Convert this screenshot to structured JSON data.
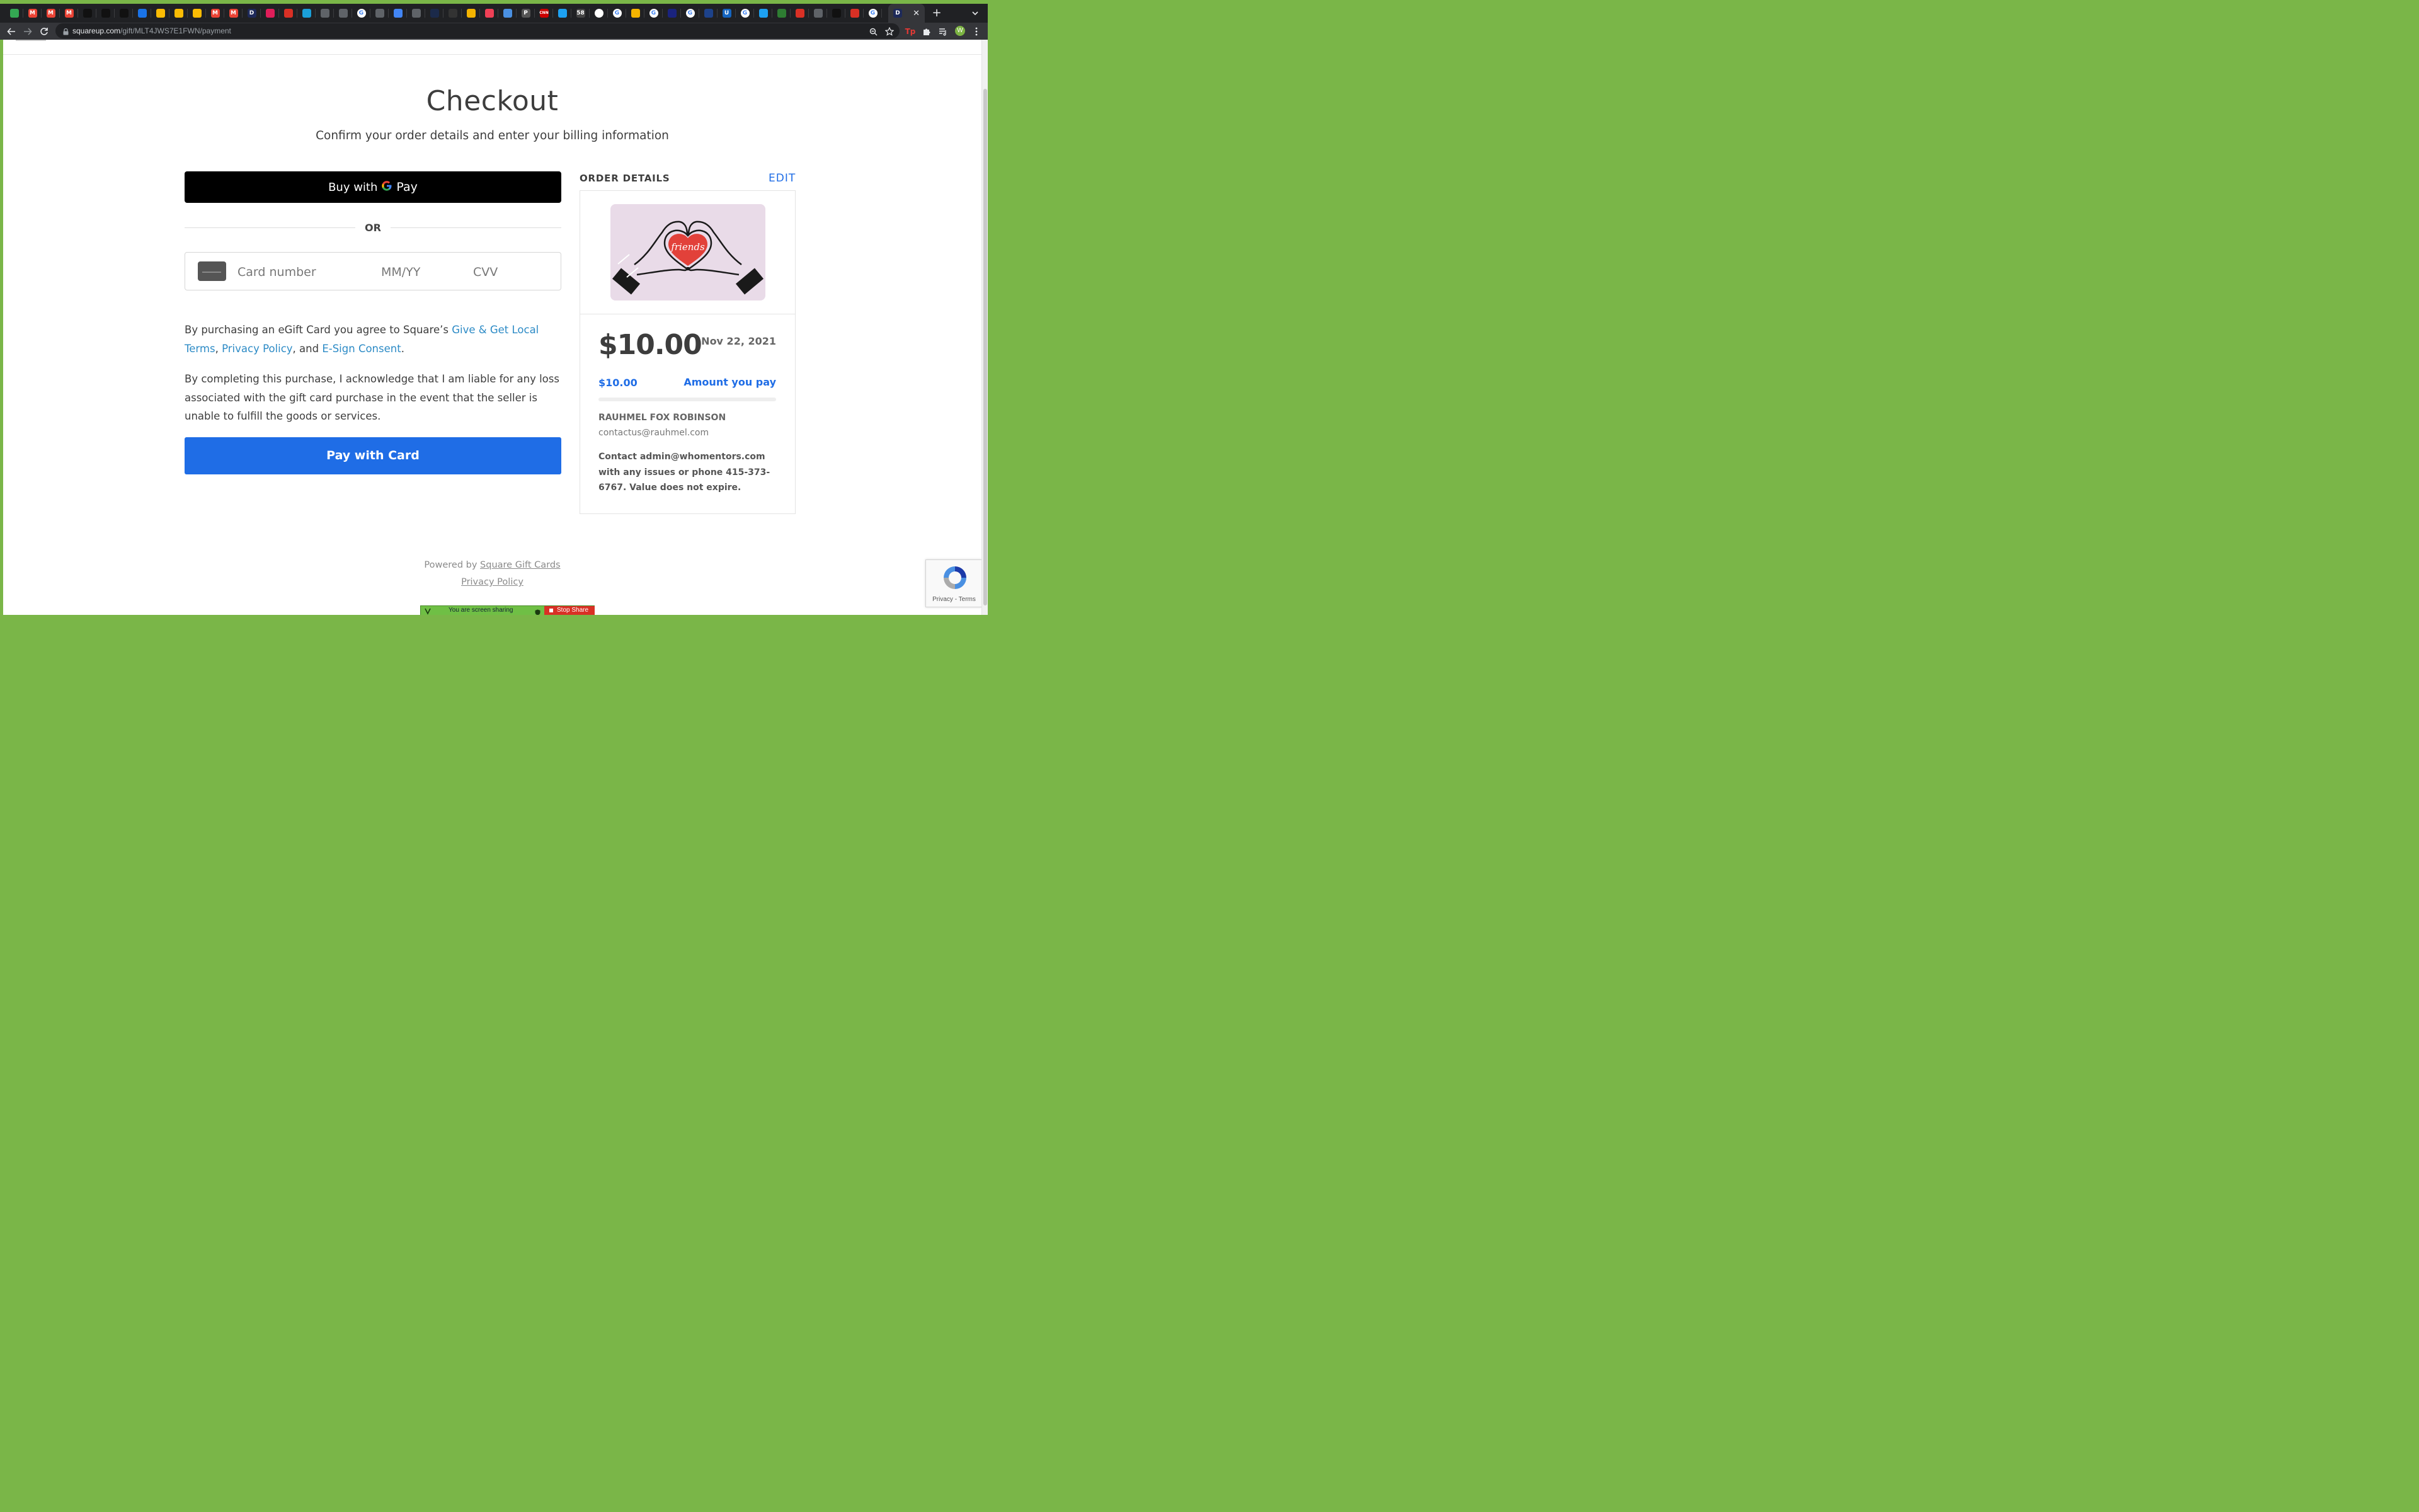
{
  "browser": {
    "tab_icons": [
      {
        "icon": "phone-icon",
        "color": "#34a853",
        "text": ""
      },
      {
        "icon": "gmail-icon",
        "color": "#ea4335",
        "text": "M"
      },
      {
        "icon": "gmail-icon",
        "color": "#ea4335",
        "text": "M"
      },
      {
        "icon": "gmail-icon",
        "color": "#ea4335",
        "text": "M"
      },
      {
        "icon": "square-icon",
        "color": "#111111",
        "text": ""
      },
      {
        "icon": "square-icon",
        "color": "#111111",
        "text": ""
      },
      {
        "icon": "square-icon",
        "color": "#111111",
        "text": ""
      },
      {
        "icon": "blue-circle-icon",
        "color": "#1a73e8",
        "text": ""
      },
      {
        "icon": "drive-icon",
        "color": "#fbbc04",
        "text": ""
      },
      {
        "icon": "drive-icon",
        "color": "#fbbc04",
        "text": ""
      },
      {
        "icon": "drive-icon",
        "color": "#fbbc04",
        "text": ""
      },
      {
        "icon": "gmail-icon",
        "color": "#ea4335",
        "text": "M"
      },
      {
        "icon": "gmail-icon",
        "color": "#ea4335",
        "text": "M"
      },
      {
        "icon": "d-icon",
        "color": "#1e2a5a",
        "text": "D"
      },
      {
        "icon": "slack-icon",
        "color": "#e01e5a",
        "text": ""
      },
      {
        "icon": "red-arrow-icon",
        "color": "#d93025",
        "text": ""
      },
      {
        "icon": "chart-icon",
        "color": "#1a9fd8",
        "text": ""
      },
      {
        "icon": "globe-icon",
        "color": "#5f6368",
        "text": ""
      },
      {
        "icon": "globe-icon",
        "color": "#5f6368",
        "text": ""
      },
      {
        "icon": "google-icon",
        "color": "#ffffff",
        "text": "G"
      },
      {
        "icon": "globe-icon",
        "color": "#5f6368",
        "text": ""
      },
      {
        "icon": "swirl-icon",
        "color": "#4285f4",
        "text": ""
      },
      {
        "icon": "globe-icon",
        "color": "#5f6368",
        "text": ""
      },
      {
        "icon": "dark-icon",
        "color": "#1b2a4a",
        "text": ""
      },
      {
        "icon": "butterfly-icon",
        "color": "#333333",
        "text": ""
      },
      {
        "icon": "yellow-icon",
        "color": "#f4b400",
        "text": ""
      },
      {
        "icon": "pocket-icon",
        "color": "#ef4056",
        "text": ""
      },
      {
        "icon": "apps-icon",
        "color": "#4a90e2",
        "text": ""
      },
      {
        "icon": "p-icon",
        "color": "#555555",
        "text": "P"
      },
      {
        "icon": "cnn-icon",
        "color": "#cc0000",
        "text": "CNN"
      },
      {
        "icon": "twitter-icon",
        "color": "#1da1f2",
        "text": ""
      },
      {
        "icon": "58-icon",
        "color": "#444444",
        "text": "58"
      },
      {
        "icon": "box-icon",
        "color": "#ffffff",
        "text": ""
      },
      {
        "icon": "google-icon",
        "color": "#ffffff",
        "text": "G"
      },
      {
        "icon": "dots-icon",
        "color": "#f4b400",
        "text": ""
      },
      {
        "icon": "google-icon",
        "color": "#ffffff",
        "text": "G"
      },
      {
        "icon": "slash-icon",
        "color": "#1a237e",
        "text": ""
      },
      {
        "icon": "google-icon",
        "color": "#ffffff",
        "text": "G"
      },
      {
        "icon": "nba-icon",
        "color": "#1d428a",
        "text": ""
      },
      {
        "icon": "u-icon",
        "color": "#1565c0",
        "text": "U"
      },
      {
        "icon": "google-icon",
        "color": "#ffffff",
        "text": "G"
      },
      {
        "icon": "twitter-icon",
        "color": "#1da1f2",
        "text": ""
      },
      {
        "icon": "palm-icon",
        "color": "#2e7d32",
        "text": ""
      },
      {
        "icon": "red-arrow-icon",
        "color": "#d93025",
        "text": ""
      },
      {
        "icon": "globe-icon",
        "color": "#5f6368",
        "text": ""
      },
      {
        "icon": "square-icon",
        "color": "#111111",
        "text": ""
      },
      {
        "icon": "red-p-icon",
        "color": "#d93025",
        "text": ""
      },
      {
        "icon": "google-icon",
        "color": "#ffffff",
        "text": "G"
      }
    ],
    "active_tab": {
      "icon": "d-icon",
      "text": "D",
      "close": "✕"
    },
    "new_tab": "+",
    "url_host": "squareup.com",
    "url_path": "/gift/MLT4JWS7E1FWN/payment",
    "avatar": "W"
  },
  "page": {
    "title": "Checkout",
    "subtitle": "Confirm your order details and enter your billing information",
    "gpay": {
      "buy": "Buy with",
      "pay": "Pay"
    },
    "or": "OR",
    "card_field": {
      "card_number_placeholder": "Card number",
      "expiry_placeholder": "MM/YY",
      "cvv_placeholder": "CVV"
    },
    "terms": {
      "prefix": "By purchasing an eGift Card you agree to Square’s ",
      "link1": "Give & Get Local Terms",
      "sep1": ", ",
      "link2": "Privacy Policy",
      "sep2": ", and ",
      "link3": "E-Sign Consent",
      "suffix": "."
    },
    "acknowledgement": "By completing this purchase, I acknowledge that I am liable for any loss associated with the gift card purchase in the event that the seller is unable to fulfill the goods or services.",
    "pay_button": "Pay with Card",
    "order": {
      "header": "ORDER DETAILS",
      "edit": "EDIT",
      "card_text": "friends",
      "amount": "$10.00",
      "date": "Nov 22, 2021",
      "pay_amount": "$10.00",
      "pay_label": "Amount you pay",
      "buyer": "RAUHMEL FOX ROBINSON",
      "email": "contactus@rauhmel.com",
      "contact": "Contact admin@whomentors.com with any issues or phone 415-373-6767. Value does not expire."
    },
    "footer": {
      "powered_prefix": "Powered by ",
      "powered_link": "Square Gift Cards",
      "privacy": "Privacy Policy"
    },
    "recaptcha": "Privacy - Terms",
    "sharing": {
      "text": "You are screen sharing",
      "stop": "Stop Share"
    }
  },
  "colors": {
    "accent": "#1f6de6",
    "link": "#2d8bc6",
    "gpay_bg": "#000000",
    "frame": "#7ab648"
  }
}
